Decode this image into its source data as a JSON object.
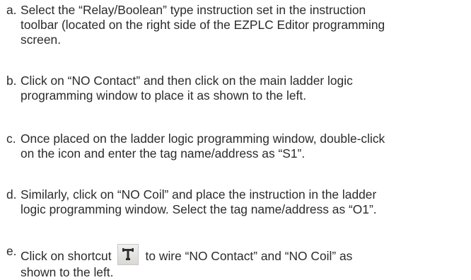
{
  "steps": [
    {
      "marker": "a.",
      "lines": [
        "Select the “Relay/Boolean” type instruction set in the instruction",
        "toolbar (located on the right side of the EZPLC Editor programming",
        "screen."
      ]
    },
    {
      "marker": "b.",
      "lines": [
        "Click on “NO Contact” and then click on the main ladder logic",
        "programming window to place it as shown to the left."
      ]
    },
    {
      "marker": "c.",
      "lines": [
        "Once placed on the ladder logic programming window, double-click",
        "on the icon and enter the tag name/address as “S1”."
      ]
    },
    {
      "marker": "d.",
      "lines": [
        "Similarly, click on “NO Coil” and place the instruction in the ladder",
        "logic programming window.  Select the tag name/address as “O1”."
      ]
    },
    {
      "marker": "e.",
      "line1_before": "Click on shortcut",
      "line1_after": "to wire “NO Contact” and “NO Coil” as",
      "line2": "shown to the left.",
      "icon": "wire-shortcut-icon"
    }
  ]
}
